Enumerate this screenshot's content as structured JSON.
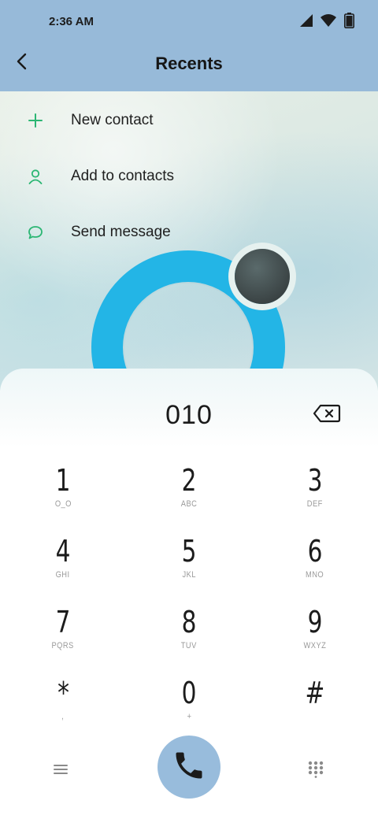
{
  "status_bar": {
    "time": "2:36 AM",
    "battery_level": "100"
  },
  "header": {
    "title": "Recents"
  },
  "menu": {
    "items": [
      {
        "label": "New contact",
        "icon": "plus-icon"
      },
      {
        "label": "Add to contacts",
        "icon": "person-icon"
      },
      {
        "label": "Send message",
        "icon": "chat-bubble-icon"
      }
    ]
  },
  "dialer": {
    "number": "010",
    "keys": [
      {
        "digit": "1",
        "letters": "O_O"
      },
      {
        "digit": "2",
        "letters": "ABC"
      },
      {
        "digit": "3",
        "letters": "DEF"
      },
      {
        "digit": "4",
        "letters": "GHI"
      },
      {
        "digit": "5",
        "letters": "JKL"
      },
      {
        "digit": "6",
        "letters": "MNO"
      },
      {
        "digit": "7",
        "letters": "PQRS"
      },
      {
        "digit": "8",
        "letters": "TUV"
      },
      {
        "digit": "9",
        "letters": "WXYZ"
      },
      {
        "digit": "*",
        "letters": ","
      },
      {
        "digit": "0",
        "letters": "+"
      },
      {
        "digit": "#",
        "letters": ""
      }
    ]
  },
  "colors": {
    "header_bg": "#97bad9",
    "accent_green": "#2bb673",
    "call_button": "#98bcdc",
    "ring": "#23b5e6"
  }
}
